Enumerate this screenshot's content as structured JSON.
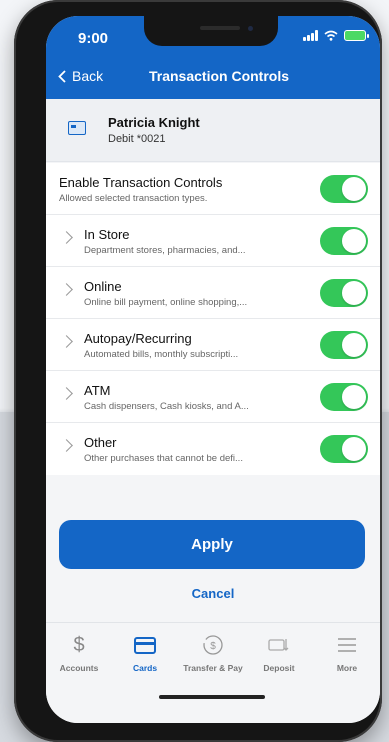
{
  "status": {
    "time": "9:00"
  },
  "header": {
    "back_label": "Back",
    "title": "Transaction Controls"
  },
  "account": {
    "name": "Patricia Knight",
    "sub": "Debit *0021"
  },
  "master": {
    "title": "Enable Transaction Controls",
    "sub": "Allowed selected transaction types.",
    "enabled": true
  },
  "controls": [
    {
      "title": "In Store",
      "sub": "Department stores, pharmacies, and...",
      "enabled": true
    },
    {
      "title": "Online",
      "sub": "Online bill payment, online shopping,...",
      "enabled": true
    },
    {
      "title": "Autopay/Recurring",
      "sub": "Automated bills, monthly subscripti...",
      "enabled": true
    },
    {
      "title": "ATM",
      "sub": "Cash dispensers, Cash kiosks, and A...",
      "enabled": true
    },
    {
      "title": "Other",
      "sub": "Other purchases that cannot be defi...",
      "enabled": true
    }
  ],
  "actions": {
    "apply_label": "Apply",
    "cancel_label": "Cancel"
  },
  "tabs": [
    {
      "label": "Accounts",
      "icon": "dollar-icon",
      "active": false
    },
    {
      "label": "Cards",
      "icon": "card-icon",
      "active": true
    },
    {
      "label": "Transfer & Pay",
      "icon": "transfer-icon",
      "active": false
    },
    {
      "label": "Deposit",
      "icon": "deposit-icon",
      "active": false
    },
    {
      "label": "More",
      "icon": "menu-icon",
      "active": false
    }
  ],
  "colors": {
    "brand": "#1466c6",
    "toggle_on": "#34c759"
  }
}
